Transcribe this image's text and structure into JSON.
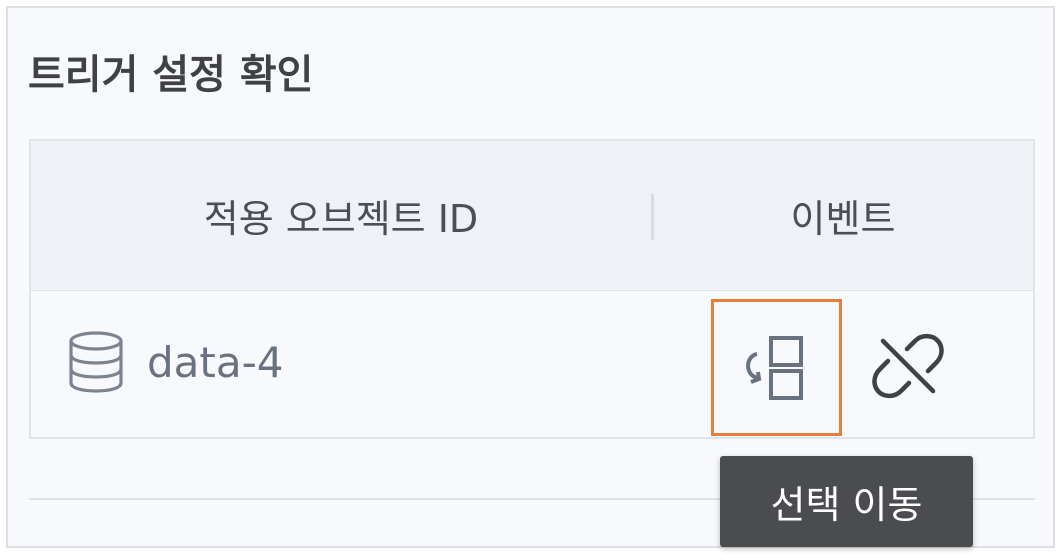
{
  "panel": {
    "title": "트리거 설정 확인"
  },
  "table": {
    "headers": {
      "object": "적용 오브젝트 ID",
      "event": "이벤트"
    },
    "rows": [
      {
        "icon": "database-icon",
        "object_id": "data-4",
        "actions": [
          {
            "name": "move-selection",
            "icon": "move-selection-icon",
            "highlighted": true
          },
          {
            "name": "unlink",
            "icon": "unlink-icon"
          }
        ]
      }
    ]
  },
  "tooltip": {
    "text": "선택 이동"
  },
  "colors": {
    "highlight_border": "#e47f3c",
    "icon_gray": "#6a7180",
    "tooltip_bg": "#4a4c50"
  }
}
